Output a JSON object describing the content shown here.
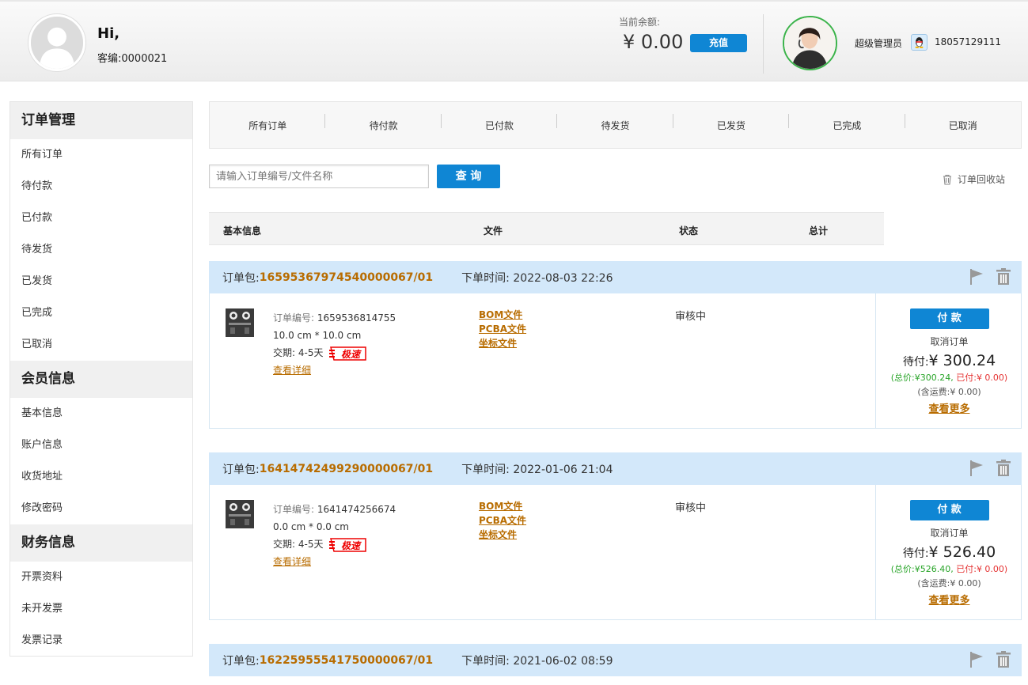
{
  "header": {
    "greeting": "Hi,",
    "customer_no": "客编:0000021",
    "balance_label": "当前余额:",
    "balance_value": "¥  0.00",
    "recharge_label": "充值",
    "admin_label": "超级管理员",
    "phone": "18057129111"
  },
  "sidebar": {
    "groups": [
      {
        "title": "订单管理",
        "items": [
          "所有订单",
          "待付款",
          "已付款",
          "待发货",
          "已发货",
          "已完成",
          "已取消"
        ]
      },
      {
        "title": "会员信息",
        "items": [
          "基本信息",
          "账户信息",
          "收货地址",
          "修改密码"
        ]
      },
      {
        "title": "财务信息",
        "items": [
          "开票资料",
          "未开发票",
          "发票记录"
        ]
      }
    ]
  },
  "tabs": [
    "所有订单",
    "待付款",
    "已付款",
    "待发货",
    "已发货",
    "已完成",
    "已取消"
  ],
  "search": {
    "placeholder": "请输入订单编号/文件名称",
    "button": "查 询",
    "recycle": "订单回收站"
  },
  "table_head": {
    "basic": "基本信息",
    "file": "文件",
    "status": "状态",
    "total": "总计"
  },
  "labels": {
    "package": "订单包:",
    "order_time": "下单时间:",
    "order_no": "订单编号:",
    "delivery": "交期:",
    "details": "查看详细",
    "pay": "付 款",
    "cancel": "取消订单",
    "to_pay": "待付:",
    "more": "查看更多"
  },
  "orders": [
    {
      "package_id": "16595367974540000067/01",
      "time": "2022-08-03 22:26",
      "order_no": "1659536814755",
      "size": "10.0 cm * 10.0 cm",
      "delivery": "4-5天",
      "files": [
        "BOM文件",
        "PCBA文件",
        "坐标文件"
      ],
      "status": "审核中",
      "to_pay": "¥ 300.24",
      "total": "(总价:¥300.24,",
      "paid": "已付:¥ 0.00)",
      "shipping": "(含运费:¥ 0.00)"
    },
    {
      "package_id": "16414742499290000067/01",
      "time": "2022-01-06 21:04",
      "order_no": "1641474256674",
      "size": "0.0 cm * 0.0 cm",
      "delivery": "4-5天",
      "files": [
        "BOM文件",
        "PCBA文件",
        "坐标文件"
      ],
      "status": "审核中",
      "to_pay": "¥ 526.40",
      "total": "(总价:¥526.40,",
      "paid": "已付:¥ 0.00)",
      "shipping": "(含运费:¥ 0.00)"
    },
    {
      "package_id": "16225955541750000067/01",
      "time": "2021-06-02 08:59"
    }
  ],
  "speed_badge": "极速"
}
